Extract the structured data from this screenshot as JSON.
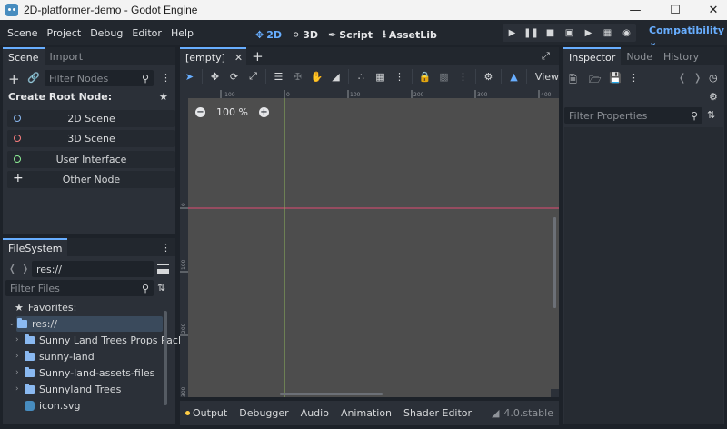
{
  "window": {
    "title": "2D-platformer-demo - Godot Engine"
  },
  "menu": [
    "Scene",
    "Project",
    "Debug",
    "Editor",
    "Help"
  ],
  "workspaces": [
    {
      "label": "2D",
      "icon": "2d-icon",
      "active": true
    },
    {
      "label": "3D",
      "icon": "3d-icon",
      "active": false
    },
    {
      "label": "Script",
      "icon": "script-icon",
      "active": false
    },
    {
      "label": "AssetLib",
      "icon": "assetlib-icon",
      "active": false
    }
  ],
  "renderer": "Compatibility",
  "scene_dock": {
    "tabs": [
      "Scene",
      "Import"
    ],
    "filter_placeholder": "Filter Nodes",
    "create_root_label": "Create Root Node:",
    "root_buttons": [
      {
        "label": "2D Scene",
        "color": "#8ab9f1"
      },
      {
        "label": "3D Scene",
        "color": "#fc7f7f"
      },
      {
        "label": "User Interface",
        "color": "#8eef97"
      },
      {
        "label": "Other Node",
        "color": "#e6e7e9"
      }
    ]
  },
  "filesystem_dock": {
    "tab": "FileSystem",
    "path": "res://",
    "filter_placeholder": "Filter Files",
    "favorites_label": "Favorites:",
    "root": "res://",
    "items": [
      {
        "label": "Sunny Land Trees Props Pack",
        "type": "folder"
      },
      {
        "label": "sunny-land",
        "type": "folder"
      },
      {
        "label": "Sunny-land-assets-files",
        "type": "folder"
      },
      {
        "label": "Sunnyland Trees",
        "type": "folder"
      },
      {
        "label": "icon.svg",
        "type": "file"
      }
    ]
  },
  "viewport": {
    "tab": "[empty]",
    "view_label": "View",
    "zoom": "100 %",
    "ruler_h": [
      "-100",
      "0",
      "100",
      "200",
      "300",
      "400"
    ],
    "ruler_v": [
      "0",
      "100",
      "200",
      "300"
    ]
  },
  "bottom_panel": {
    "tabs": [
      "Output",
      "Debugger",
      "Audio",
      "Animation",
      "Shader Editor"
    ],
    "version": "4.0.stable"
  },
  "inspector_dock": {
    "tabs": [
      "Inspector",
      "Node",
      "History"
    ],
    "filter_placeholder": "Filter Properties"
  },
  "colors": {
    "accent": "#68aeff",
    "x_axis": "#e04a74",
    "y_axis": "#8db35a",
    "canvas": "#4d4d4d"
  }
}
